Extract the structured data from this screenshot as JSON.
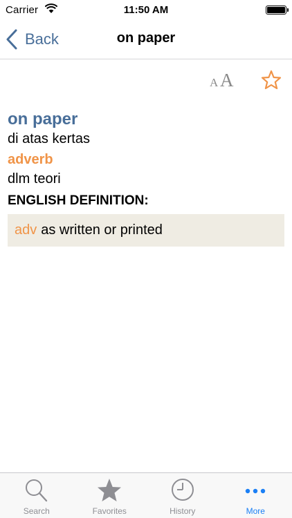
{
  "status_bar": {
    "carrier": "Carrier",
    "time": "11:50 AM"
  },
  "nav": {
    "back_label": "Back",
    "title": "on paper"
  },
  "entry": {
    "headword": "on paper",
    "translation": "di atas kertas",
    "part_of_speech": "adverb",
    "meaning": "dlm teori",
    "definition_heading": "ENGLISH DEFINITION:",
    "definitions": [
      {
        "pos": "adv",
        "text": "as written or printed"
      }
    ]
  },
  "font_size_button": {
    "small": "A",
    "large": "A"
  },
  "tab_bar": {
    "tabs": [
      {
        "label": "Search",
        "icon": "search-icon"
      },
      {
        "label": "Favorites",
        "icon": "star-icon"
      },
      {
        "label": "History",
        "icon": "clock-icon"
      },
      {
        "label": "More",
        "icon": "more-icon",
        "active": true
      }
    ]
  },
  "colors": {
    "accent": "#486e99",
    "pos": "#f09448",
    "active_tab": "#1a7ff5",
    "def_bg": "#efece3"
  }
}
